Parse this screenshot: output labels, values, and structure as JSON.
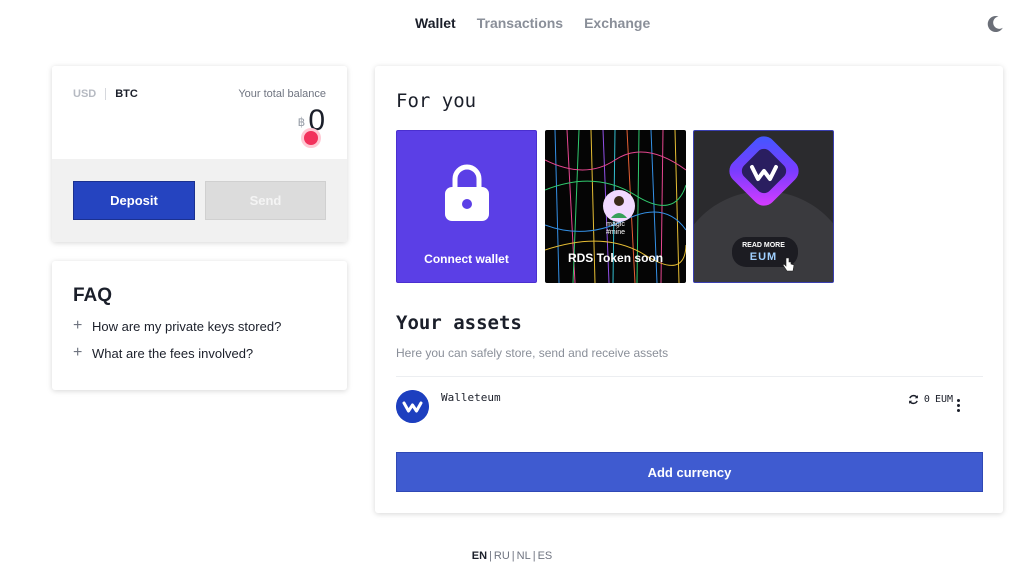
{
  "nav": {
    "tabs": [
      {
        "label": "Wallet",
        "active": true
      },
      {
        "label": "Transactions",
        "active": false
      },
      {
        "label": "Exchange",
        "active": false
      }
    ],
    "theme_icon": "moon-icon"
  },
  "balance": {
    "currency_usd": "USD",
    "currency_btc": "BTC",
    "label": "Your total balance",
    "symbol": "฿",
    "amount": "0",
    "deposit_label": "Deposit",
    "send_label": "Send"
  },
  "faq": {
    "title": "FAQ",
    "items": [
      {
        "label": "How are my private keys stored?"
      },
      {
        "label": "What are the fees involved?"
      }
    ]
  },
  "for_you": {
    "title": "For you",
    "cards": [
      {
        "label": "Connect wallet",
        "icon": "lock-icon",
        "color": "#5b3fe6"
      },
      {
        "label": "RDS Token soon",
        "icon": "magic-mine-image",
        "mini_text": "magic\n#mine"
      },
      {
        "label": "",
        "icon": "walleteum-logo-image",
        "overlay_text": "READ MORE",
        "overlay_sub": "EUM"
      }
    ]
  },
  "assets": {
    "title": "Your assets",
    "subtitle": "Here you can safely store, send and receive assets",
    "items": [
      {
        "name": "Walleteum",
        "balance": "0",
        "ticker": "EUM",
        "icon": "walleteum-icon"
      }
    ],
    "add_label": "Add currency"
  },
  "footer": {
    "languages": [
      {
        "code": "EN",
        "active": true
      },
      {
        "code": "RU",
        "active": false
      },
      {
        "code": "NL",
        "active": false
      },
      {
        "code": "ES",
        "active": false
      }
    ]
  },
  "colors": {
    "primary": "#2544c0",
    "accent_purple": "#5b3fe6",
    "alert_pink": "#f2325c"
  }
}
